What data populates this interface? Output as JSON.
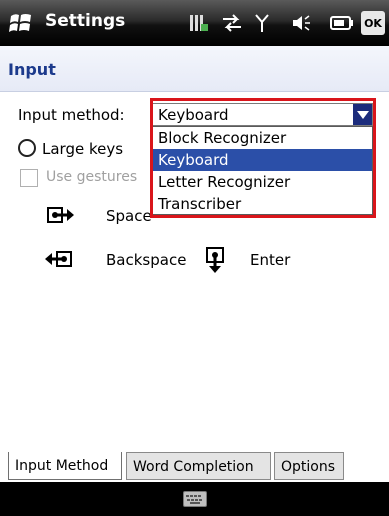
{
  "titlebar": {
    "title": "Settings",
    "ok_label": "OK",
    "icons": [
      "windows-flag-icon",
      "battery-charge-icon",
      "data-connection-icon",
      "signal-icon",
      "volume-icon",
      "battery-icon"
    ]
  },
  "header": {
    "title": "Input"
  },
  "form": {
    "input_method_label": "Input method:",
    "input_method_value": "Keyboard",
    "dropdown_options": [
      "Block Recognizer",
      "Keyboard",
      "Letter Recognizer",
      "Transcriber"
    ],
    "selected_option": "Keyboard",
    "large_keys_label": "Large keys",
    "use_gestures_label": "Use gestures"
  },
  "gestures": {
    "space_label": "Space",
    "backspace_label": "Backspace",
    "enter_label": "Enter"
  },
  "tabs": [
    {
      "label": "Input Method",
      "active": true
    },
    {
      "label": "Word Completion",
      "active": false
    },
    {
      "label": "Options",
      "active": false
    }
  ],
  "colors": {
    "titlebar": "#000000",
    "header_text": "#1c3a8c",
    "selection": "#2b4fa8",
    "highlight_border": "#d9151b"
  }
}
